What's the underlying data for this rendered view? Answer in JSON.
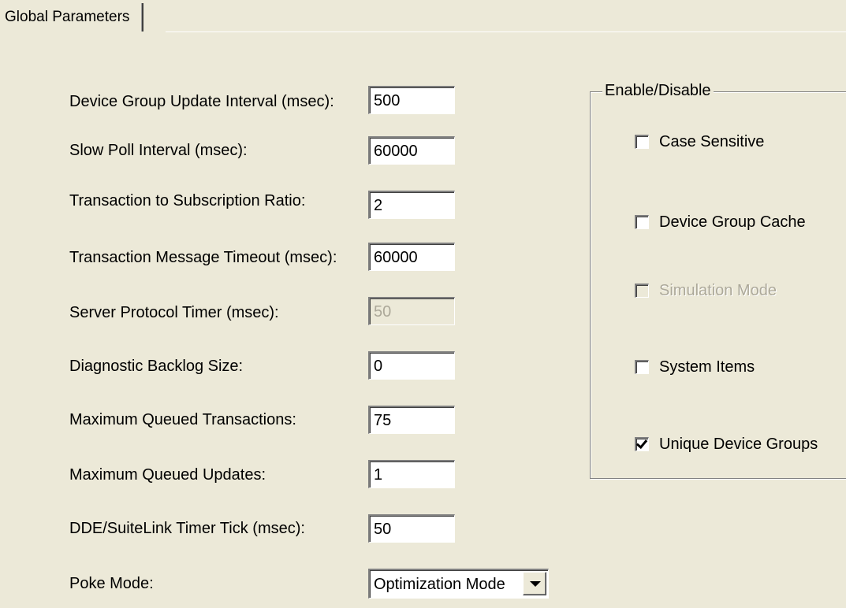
{
  "tab": {
    "label": "Global Parameters"
  },
  "parameters": [
    {
      "label": "Device Group Update Interval (msec):",
      "value": "500",
      "enabled": true
    },
    {
      "label": "Slow Poll Interval (msec):",
      "value": "60000",
      "enabled": true
    },
    {
      "label": "Transaction to Subscription Ratio:",
      "value": "2",
      "enabled": true
    },
    {
      "label": "Transaction Message Timeout (msec):",
      "value": "60000",
      "enabled": true
    },
    {
      "label": "Server Protocol Timer (msec):",
      "value": "50",
      "enabled": false
    },
    {
      "label": "Diagnostic Backlog Size:",
      "value": "0",
      "enabled": true
    },
    {
      "label": "Maximum Queued Transactions:",
      "value": "75",
      "enabled": true
    },
    {
      "label": "Maximum Queued Updates:",
      "value": "1",
      "enabled": true
    },
    {
      "label": "DDE/SuiteLink Timer Tick (msec):",
      "value": "50",
      "enabled": true
    }
  ],
  "poke_mode": {
    "label": "Poke Mode:",
    "value": "Optimization Mode"
  },
  "enable_disable": {
    "title": "Enable/Disable",
    "options": [
      {
        "label": "Case Sensitive",
        "checked": false,
        "enabled": true
      },
      {
        "label": "Device Group Cache",
        "checked": false,
        "enabled": true
      },
      {
        "label": "Simulation Mode",
        "checked": false,
        "enabled": false
      },
      {
        "label": "System Items",
        "checked": false,
        "enabled": true
      },
      {
        "label": "Unique Device Groups",
        "checked": true,
        "enabled": true
      }
    ]
  },
  "colors": {
    "dialog_background": "#ece9d8",
    "field_background": "#ffffff",
    "disabled_text": "#aca899"
  }
}
